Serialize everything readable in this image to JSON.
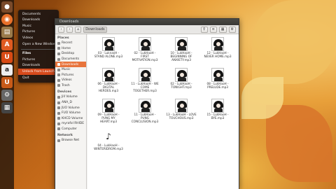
{
  "quicklist": {
    "items": [
      {
        "label": "Documents",
        "style": "item"
      },
      {
        "label": "Downloads",
        "style": "item"
      },
      {
        "label": "Music",
        "style": "item"
      },
      {
        "label": "Pictures",
        "style": "item"
      },
      {
        "label": "Videos",
        "style": "item"
      },
      {
        "label": "Open a New Window",
        "style": "item"
      },
      {
        "label": "Files",
        "style": "head"
      },
      {
        "label": "Pictures",
        "style": "item"
      },
      {
        "label": "Downloads",
        "style": "item"
      },
      {
        "label": "Unlock from Launcher",
        "style": "selected"
      },
      {
        "label": "Quit",
        "style": "item"
      }
    ]
  },
  "window": {
    "title": "Downloads",
    "path_button": "Downloads"
  },
  "sidebar": {
    "sections": [
      {
        "title": "Places",
        "items": [
          "Recent",
          "Home",
          "Desktop",
          "Documents",
          "Downloads",
          "Music",
          "Pictures",
          "Videos",
          "Trash"
        ],
        "selected": "Downloads"
      },
      {
        "title": "Devices",
        "items": [
          "Jill Volume",
          "ANA_D",
          "JUO Volume",
          "FUO Volume",
          "KHCD Volume",
          "myrafol RHIDE",
          "Computer"
        ]
      },
      {
        "title": "Network",
        "items": [
          "Browse Net"
        ]
      }
    ]
  },
  "files": [
    {
      "name": "03 - LuknasH - STAND ALONE.mp3",
      "type": "thumb"
    },
    {
      "name": "02 - LukHaoH - FIRST MOTIVATION.mp3",
      "type": "thumb"
    },
    {
      "name": "10 - LukHaoH - BEGINNING OF ANXIETY.mp3",
      "type": "thumb"
    },
    {
      "name": "12 - LukHaoH - NEVER HOME.mp3",
      "type": "thumb"
    },
    {
      "name": "06 - LukHaoH - DIGITAL HEROES.mp3",
      "type": "thumb"
    },
    {
      "name": "11 - LukHaoH - WE COME TOGETHER.mp3",
      "type": "thumb"
    },
    {
      "name": "02 - LukHaoH - TONIGHT.mp3",
      "type": "thumb"
    },
    {
      "name": "08 - LukHaoH - PRELUDE.mp3",
      "type": "thumb"
    },
    {
      "name": "09 - LukHaoH - PUNG MY HEART.mp3",
      "type": "thumb"
    },
    {
      "name": "11 - LukHaoH - PUNG CONCLUSION.mp3",
      "type": "thumb"
    },
    {
      "name": "13 - LukHaoH - LOVE TOUCHOUS.mp3",
      "type": "thumb"
    },
    {
      "name": "15 - LukHaoH - BYE.mp3",
      "type": "thumb"
    },
    {
      "name": "04 - LukHaoH - WINTERIDROM.mp3",
      "type": "note"
    }
  ],
  "icons": {
    "note": "♪",
    "back": "‹",
    "forward": "›",
    "home": "⌂",
    "search": "⚲",
    "list_view": "≡",
    "grid_view": "▦",
    "settings": "⚙"
  },
  "colors": {
    "accent": "#e8743c",
    "menu_selected": "#d64a1c"
  }
}
